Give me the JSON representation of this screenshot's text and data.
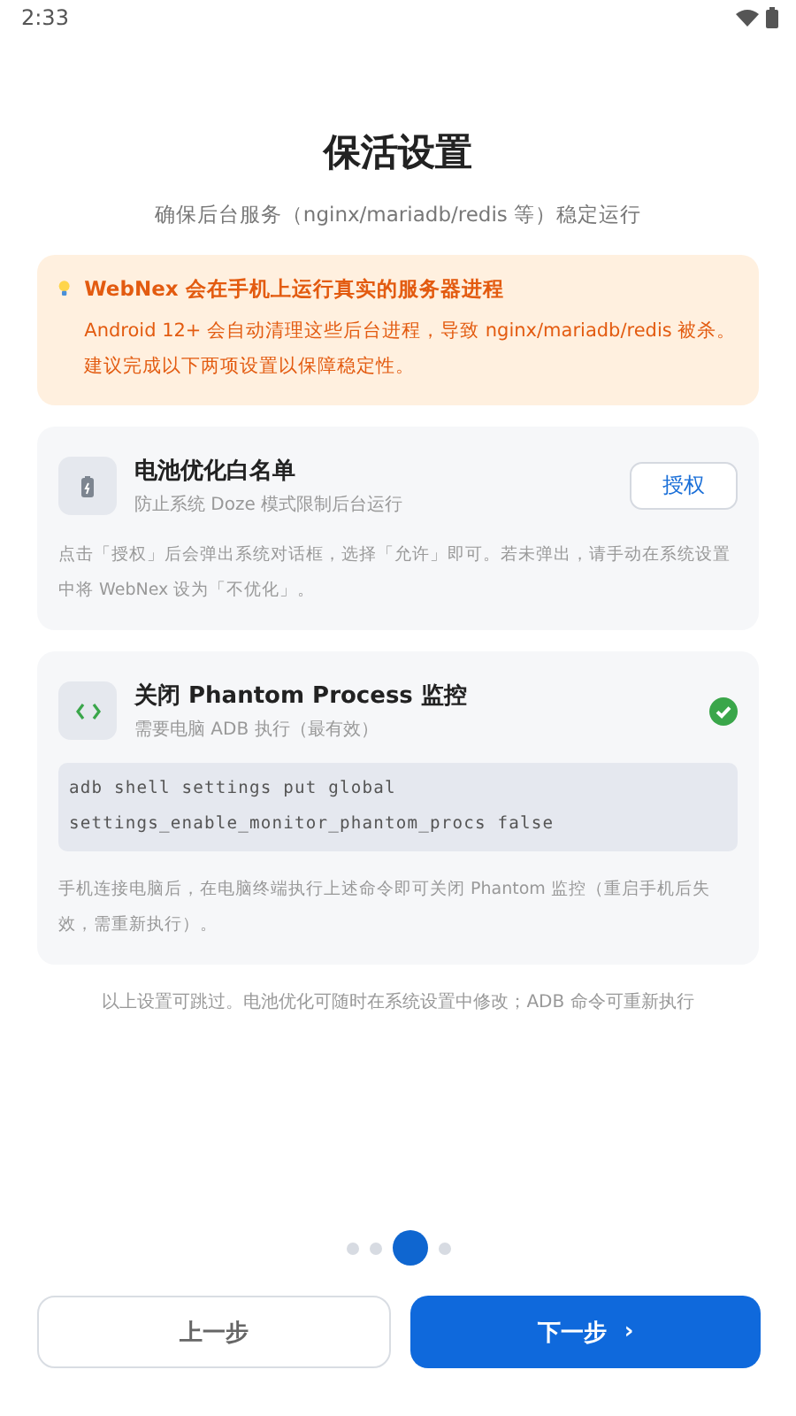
{
  "status_bar": {
    "time": "2:33"
  },
  "title": "保活设置",
  "subtitle": "确保后台服务（nginx/mariadb/redis 等）稳定运行",
  "notice": {
    "title": "WebNex 会在手机上运行真实的服务器进程",
    "body": "Android 12+ 会自动清理这些后台进程，导致 nginx/mariadb/redis 被杀。建议完成以下两项设置以保障稳定性。"
  },
  "cards": [
    {
      "kind": "battery",
      "title": "电池优化白名单",
      "subtitle": "防止系统 Doze 模式限制后台运行",
      "button": "授权",
      "completed": false,
      "note": "点击「授权」后会弹出系统对话框，选择「允许」即可。若未弹出，请手动在系统设置中将 WebNex 设为「不优化」。"
    },
    {
      "kind": "code",
      "title": "关闭 Phantom Process 监控",
      "subtitle": "需要电脑 ADB 执行（最有效）",
      "completed": true,
      "command": [
        "adb shell settings put global",
        "settings_enable_monitor_phantom_procs false"
      ],
      "note": "手机连接电脑后，在电脑终端执行上述命令即可关闭 Phantom 监控（重启手机后失效，需重新执行）。"
    }
  ],
  "footnote": "以上设置可跳过。电池优化可随时在系统设置中修改；ADB 命令可重新执行",
  "pager": [
    {
      "selected": false
    },
    {
      "selected": false
    },
    {
      "selected": true
    },
    {
      "selected": false
    }
  ],
  "buttons": [
    {
      "kind": "secondary",
      "label": "上一步"
    },
    {
      "kind": "primary",
      "label": "下一步",
      "trailing": "›"
    }
  ]
}
